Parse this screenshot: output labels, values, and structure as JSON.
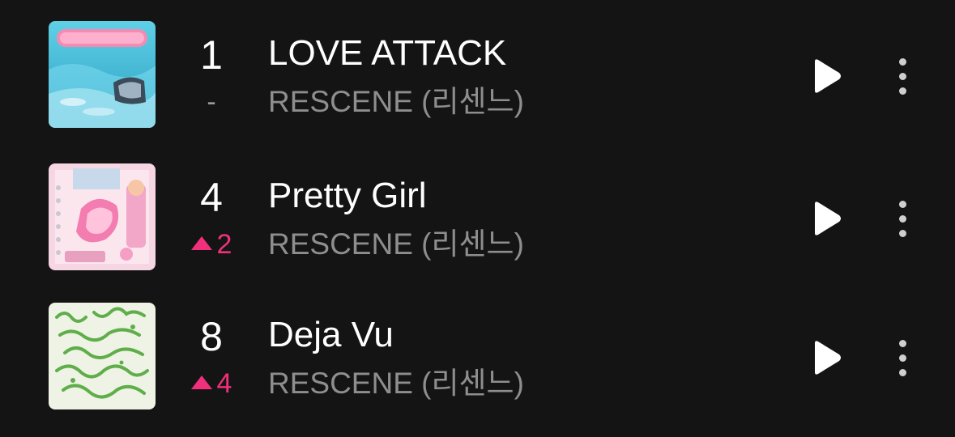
{
  "colors": {
    "background": "#141414",
    "title": "#ffffff",
    "artist": "#8e8e8e",
    "rank_up": "#f0307a",
    "rank_same": "#9a9a9a"
  },
  "tracks": [
    {
      "rank": "1",
      "change": "-",
      "change_direction": "none",
      "title": "LOVE ATTACK",
      "artist": "RESCENE (리센느)",
      "cover_icon": "album-cover-love-attack",
      "play_icon": "play-icon",
      "more_icon": "more-vertical-icon"
    },
    {
      "rank": "4",
      "change": "2",
      "change_direction": "up",
      "title": "Pretty Girl",
      "artist": "RESCENE (리센느)",
      "cover_icon": "album-cover-pretty-girl",
      "play_icon": "play-icon",
      "more_icon": "more-vertical-icon"
    },
    {
      "rank": "8",
      "change": "4",
      "change_direction": "up",
      "title": "Deja Vu",
      "artist": "RESCENE (리센느)",
      "cover_icon": "album-cover-deja-vu",
      "play_icon": "play-icon",
      "more_icon": "more-vertical-icon"
    }
  ]
}
